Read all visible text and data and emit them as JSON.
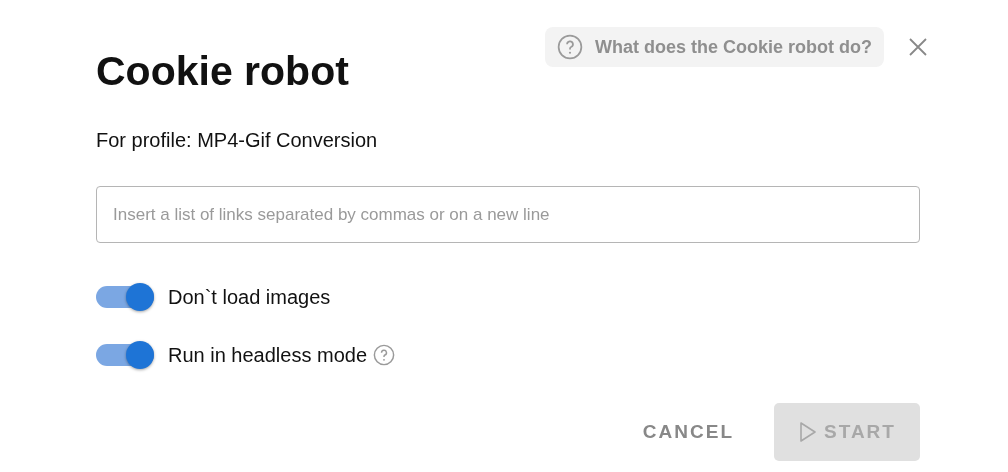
{
  "dialog": {
    "title": "Cookie robot",
    "help_link": "What does the Cookie robot do?",
    "profile_line": "For profile: MP4-Gif Conversion"
  },
  "links_field": {
    "placeholder": "Insert a list of links separated by commas or on a new line"
  },
  "options": [
    {
      "label": "Don`t load images",
      "on": true,
      "help": false
    },
    {
      "label": "Run in headless mode",
      "on": true,
      "help": true
    }
  ],
  "buttons": {
    "cancel": {
      "label": "CANCEL"
    },
    "start": {
      "label": "START",
      "disabled": true
    }
  }
}
